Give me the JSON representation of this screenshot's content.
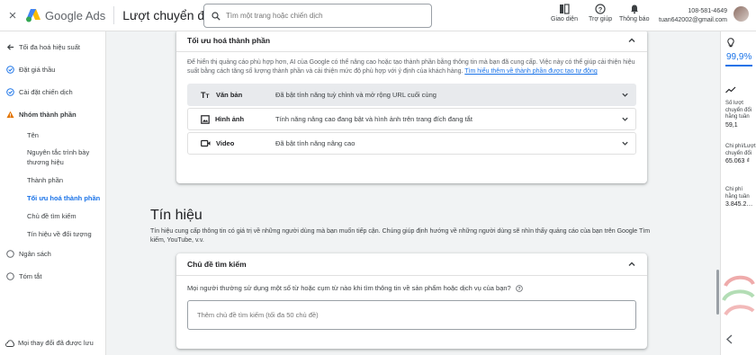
{
  "app": {
    "product": "Google Ads",
    "page_title": "Lượt chuyển đổi",
    "close_label": "×"
  },
  "search": {
    "placeholder": "Tìm một trang hoặc chiến dịch"
  },
  "toolbar": {
    "appearance": "Giao diện",
    "help": "Trợ giúp",
    "notifications": "Thông báo"
  },
  "account": {
    "id": "108-581-4649",
    "email": "tuan642002@gmail.com"
  },
  "sidebar": {
    "items": [
      {
        "label": "Tối đa hoá hiệu suất",
        "icon": "arrow-back-icon"
      },
      {
        "label": "Đặt giá thầu",
        "icon": "check-circle-icon"
      },
      {
        "label": "Cài đặt chiến dịch",
        "icon": "check-circle-icon"
      },
      {
        "label": "Nhóm thành phần",
        "icon": "warning-icon"
      }
    ],
    "subitems": [
      {
        "label": "Tên"
      },
      {
        "label": "Nguyên tắc trình bày thương hiệu"
      },
      {
        "label": "Thành phần"
      },
      {
        "label": "Tối ưu hoá thành phần"
      },
      {
        "label": "Chủ đề tìm kiếm"
      },
      {
        "label": "Tín hiệu về đối tượng"
      }
    ],
    "bottom_items": [
      {
        "label": "Ngân sách",
        "icon": "empty-circle-icon"
      },
      {
        "label": "Tóm tắt",
        "icon": "empty-circle-icon"
      }
    ],
    "saved_label": "Mọi thay đổi đã được lưu"
  },
  "optimize": {
    "title": "Tối ưu hoá thành phần",
    "description": "Để hiển thị quảng cáo phù hợp hơn, AI của Google có thể nâng cao hoặc tạo thành phần bằng thông tin mà bạn đã cung cấp. Việc này có thể giúp cải thiện hiệu suất bằng cách tăng số lượng thành phần và cải thiện mức độ phù hợp với ý định của khách hàng.",
    "link": "Tìm hiểu thêm về thành phần được tạo tự động",
    "rows": [
      {
        "name": "Văn bản",
        "icon": "text-icon",
        "status": "Đã bật tính năng tuỳ chỉnh và mở rộng URL cuối cùng"
      },
      {
        "name": "Hình ảnh",
        "icon": "image-icon",
        "status": "Tính năng nâng cao đang bật và hình ảnh trên trang đích đang tắt"
      },
      {
        "name": "Video",
        "icon": "video-icon",
        "status": "Đã bật tính năng nâng cao"
      }
    ]
  },
  "signals": {
    "title": "Tín hiệu",
    "description": "Tín hiệu cung cấp thông tin có giá trị về những người dùng mà bạn muốn tiếp cận. Chúng giúp định hướng về những người dùng sẽ nhìn thấy quảng cáo của bạn trên Google Tìm kiếm, YouTube, v.v."
  },
  "search_topics": {
    "title": "Chủ đề tìm kiếm",
    "question": "Mọi người thường sử dụng một số từ hoặc cụm từ nào khi tìm thông tin về sản phẩm hoặc dịch vụ của bạn?",
    "placeholder": "Thêm chủ đề tìm kiếm (tối đa 50 chủ đề)"
  },
  "right_panel": {
    "optimization": "99,9%",
    "metrics": [
      {
        "label": "Số lượt chuyển đổi hằng tuần",
        "value": "59,1"
      },
      {
        "label": "Chi phí/Lượt chuyển đổi",
        "value": "65.063 ₫"
      },
      {
        "label": "Chi phí hằng tuần",
        "value": "3.845.2…"
      }
    ]
  },
  "colors": {
    "accent": "#1a73e8",
    "warning": "#e37400",
    "success": "#1a73e8"
  }
}
